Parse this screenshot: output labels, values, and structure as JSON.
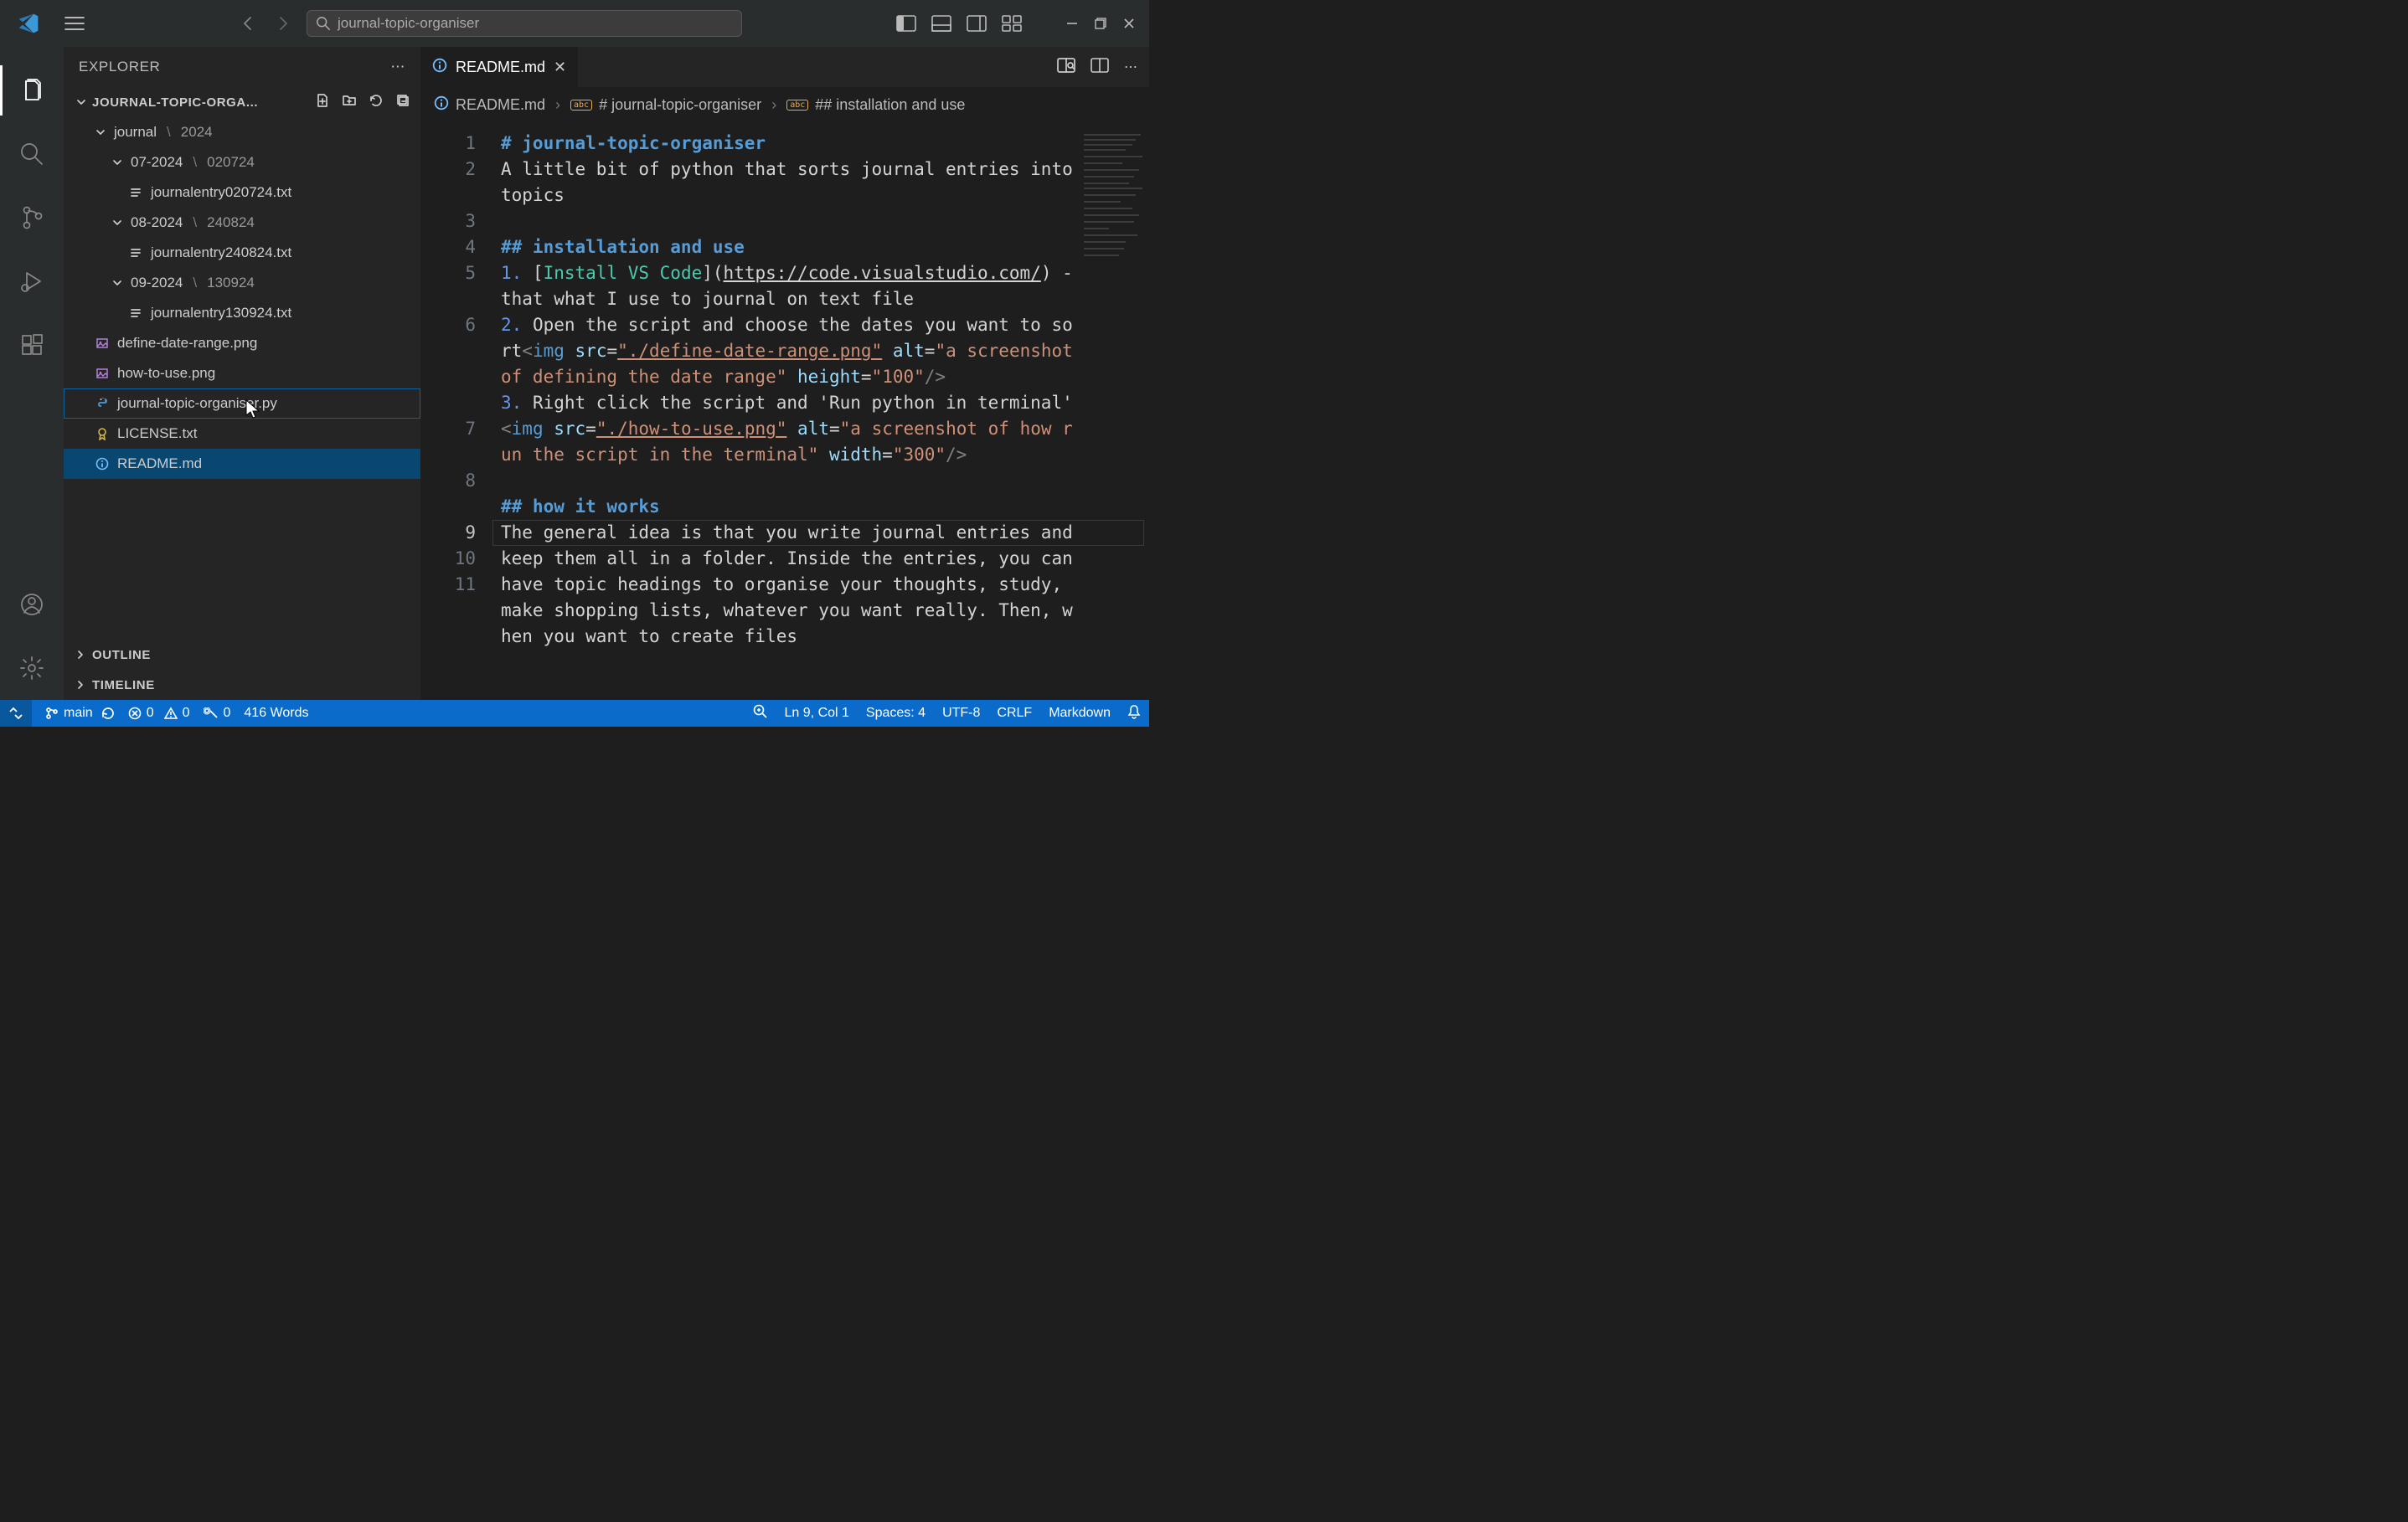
{
  "titlebar": {
    "search": "journal-topic-organiser"
  },
  "sidebar": {
    "title": "EXPLORER",
    "project": "JOURNAL-TOPIC-ORGA...",
    "outline": "OUTLINE",
    "timeline": "TIMELINE",
    "tree": {
      "folder_journal": "journal",
      "folder_journal_sub": "2024",
      "folder_07": "07-2024",
      "folder_07_sub": "020724",
      "file_07": "journalentry020724.txt",
      "folder_08": "08-2024",
      "folder_08_sub": "240824",
      "file_08": "journalentry240824.txt",
      "folder_09": "09-2024",
      "folder_09_sub": "130924",
      "file_09": "journalentry130924.txt",
      "file_png1": "define-date-range.png",
      "file_png2": "how-to-use.png",
      "file_py": "journal-topic-organiser.py",
      "file_license": "LICENSE.txt",
      "file_readme": "README.md"
    }
  },
  "tabs": {
    "readme": "README.md"
  },
  "breadcrumbs": {
    "file": "README.md",
    "h1": "# journal-topic-organiser",
    "h2": "## installation and use"
  },
  "editor": {
    "lines": [
      "1",
      "2",
      "3",
      "4",
      "5",
      "6",
      "7",
      "8",
      "9",
      "10",
      "11"
    ],
    "l1": "# journal-topic-organiser",
    "l2": "A little bit of python that sorts journal entries into topics",
    "l3": "",
    "l4": "## installation and use",
    "l5_a": "1.",
    "l5_b": " [",
    "l5_c": "Install VS Code",
    "l5_d": "](",
    "l5_e": "https://code.visualstudio.com/",
    "l5_f": ") - that what I use to journal on text file",
    "l6_a": "2.",
    "l6_b": " Open the script and choose the dates you want to sort",
    "l6_c": "<",
    "l6_d": "img",
    "l6_e": " src",
    "l6_f": "=",
    "l6_g": "\"./define-date-range.png\"",
    "l6_h": " alt",
    "l6_i": "=",
    "l6_j": "\"a screenshot of defining the date range\"",
    "l6_k": " height",
    "l6_l": "=",
    "l6_m": "\"100\"",
    "l6_n": "/>",
    "l7_a": "3.",
    "l7_b": " Right click the script and 'Run python in terminal'",
    "l8_a": "<",
    "l8_b": "img",
    "l8_c": " src",
    "l8_d": "=",
    "l8_e": "\"./how-to-use.png\"",
    "l8_f": " alt",
    "l8_g": "=",
    "l8_h": "\"a screenshot of how run the script in the terminal\"",
    "l8_i": " width",
    "l8_j": "=",
    "l8_k": "\"300\"",
    "l8_l": "/>",
    "l10": "## how it works",
    "l11": "The general idea is that you write journal entries and keep them all in a folder. Inside the entries, you can have topic headings to organise your thoughts, study, make shopping lists, whatever you want really. Then, when you want to create files"
  },
  "status": {
    "branch": "main",
    "errors": "0",
    "warnings": "0",
    "ports": "0",
    "words": "416 Words",
    "pos": "Ln 9, Col 1",
    "spaces": "Spaces: 4",
    "encoding": "UTF-8",
    "eol": "CRLF",
    "lang": "Markdown"
  }
}
